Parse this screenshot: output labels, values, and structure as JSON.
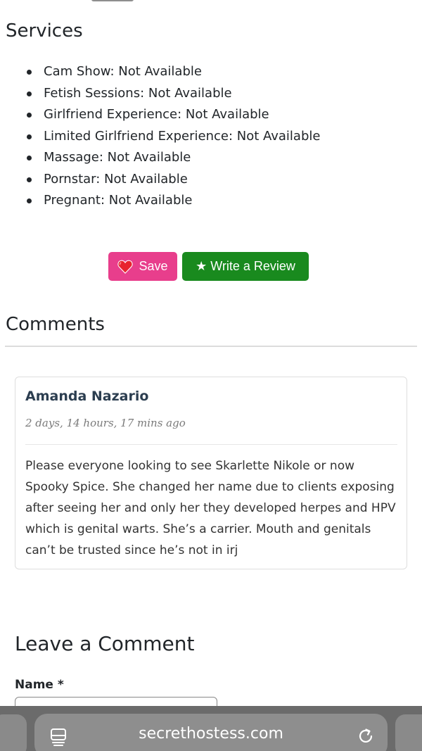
{
  "services": {
    "title": "Services",
    "items": [
      "Cam Show: Not Available",
      "Fetish Sessions: Not Available",
      "Girlfriend Experience: Not Available",
      "Limited Girlfriend Experience: Not Available",
      "Massage: Not Available",
      "Pornstar: Not Available",
      "Pregnant: Not Available"
    ]
  },
  "actions": {
    "save_label": "Save",
    "review_label": "★ Write a Review",
    "save_color": "#e83e8c",
    "review_color": "#198a1e"
  },
  "comments": {
    "title": "Comments",
    "items": [
      {
        "author": "Amanda Nazario",
        "time": "2 days, 14 hours, 17 mins ago",
        "body": "Please everyone looking to see Skarlette Nikole or now Spooky Spice. She changed her name due to clients exposing after seeing her and only her they developed herpes and HPV which is genital warts. She’s a carrier. Mouth and genitals can’t be trusted since he’s not in irj"
      }
    ]
  },
  "form": {
    "title": "Leave a Comment",
    "name_label": "Name *",
    "name_value": ""
  },
  "browser": {
    "url": "secrethostess.com",
    "icons": [
      "reader-mode-icon",
      "reload-icon"
    ]
  }
}
